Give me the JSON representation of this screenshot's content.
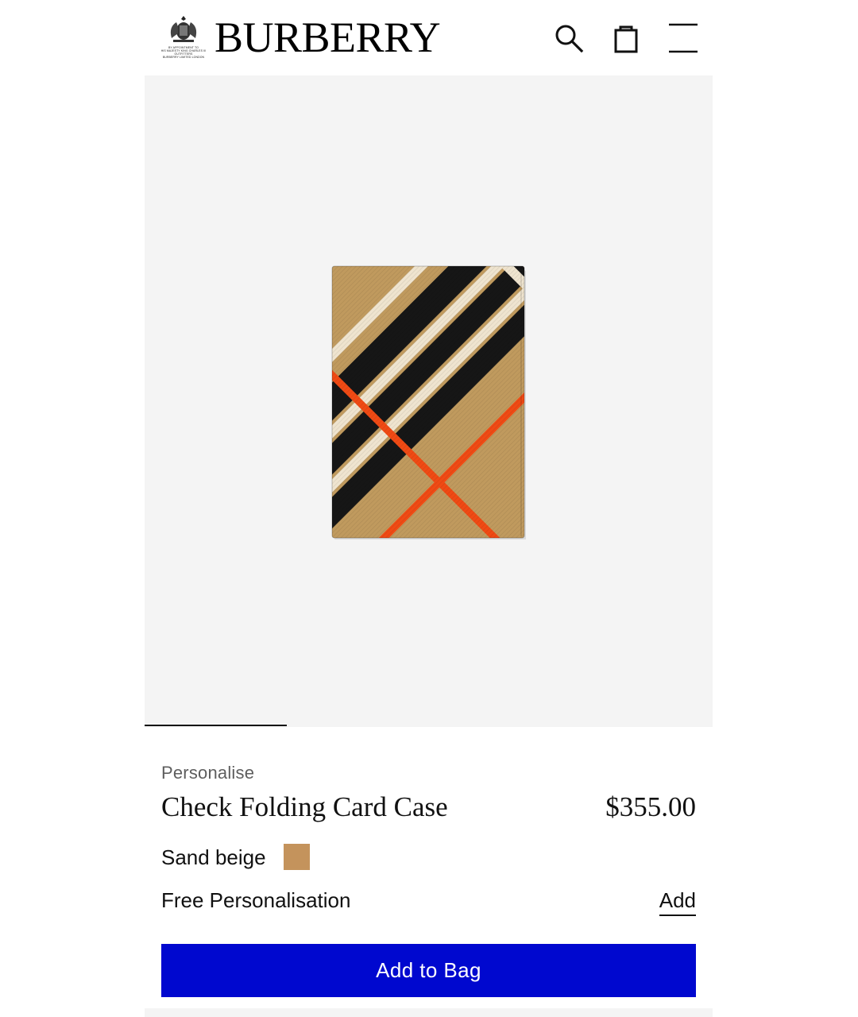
{
  "header": {
    "brand": "BURBERRY",
    "crest_caption": "BY APPOINTMENT TO\nHIS MAJESTY KING CHARLES III\nOUTFITTERS\nBURBERRY LIMITED LONDON",
    "icons": [
      "search-icon",
      "shopping-bag-icon",
      "menu-icon"
    ]
  },
  "gallery": {
    "progress": 0.25,
    "image_colors": {
      "sand": "#c09a5e",
      "black": "#161616",
      "cream": "#efe4cf",
      "red": "#f04a14",
      "background": "#f4f4f4"
    }
  },
  "product": {
    "personalise_label": "Personalise",
    "title": "Check Folding Card Case",
    "price": "$355.00",
    "color_name": "Sand beige",
    "swatch_color": "#c4935c",
    "personalisation_text": "Free Personalisation",
    "personalisation_action": "Add",
    "cta_label": "Add to Bag",
    "cta_color": "#0008cf"
  }
}
